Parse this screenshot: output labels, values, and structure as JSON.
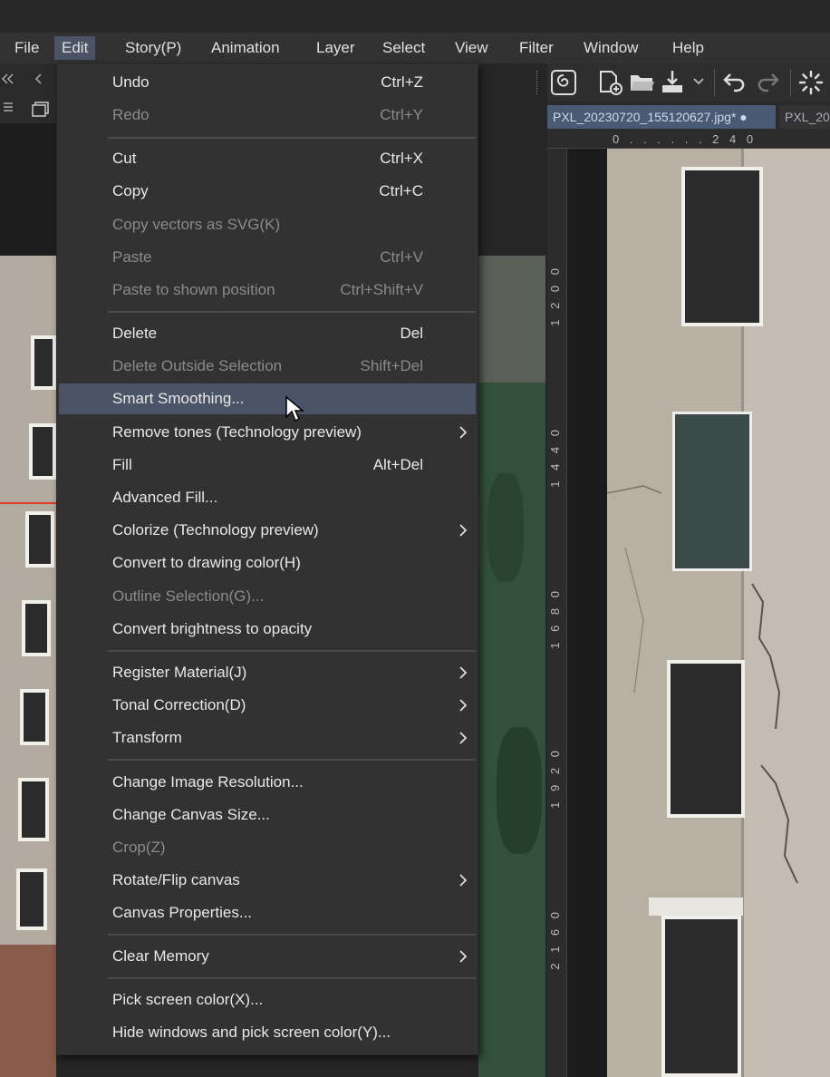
{
  "menubar": {
    "items": [
      "File",
      "Edit",
      "Story(P)",
      "Animation",
      "Layer",
      "Select",
      "View",
      "Filter",
      "Window",
      "Help"
    ],
    "active": "Edit"
  },
  "document": {
    "tabs": [
      "PXL_20230720_155120627.jpg* ●",
      "PXL_2023"
    ],
    "ruler_h_label": "0 . . . . . . 2 4 0",
    "ruler_v_labels": [
      "1 2 0 0",
      "1 4 4 0",
      "1 6 8 0",
      "1 9 2 0",
      "2 1 6 0"
    ]
  },
  "edit_menu": {
    "items": [
      {
        "label": "Undo",
        "shortcut": "Ctrl+Z",
        "disabled": false
      },
      {
        "label": "Redo",
        "shortcut": "Ctrl+Y",
        "disabled": true
      },
      {
        "label": "Cut",
        "shortcut": "Ctrl+X",
        "disabled": false
      },
      {
        "label": "Copy",
        "shortcut": "Ctrl+C",
        "disabled": false
      },
      {
        "label": "Copy vectors as SVG(K)",
        "shortcut": "",
        "disabled": true
      },
      {
        "label": "Paste",
        "shortcut": "Ctrl+V",
        "disabled": true
      },
      {
        "label": "Paste to shown position",
        "shortcut": "Ctrl+Shift+V",
        "disabled": true
      },
      {
        "label": "Delete",
        "shortcut": "Del",
        "disabled": false
      },
      {
        "label": "Delete Outside Selection",
        "shortcut": "Shift+Del",
        "disabled": true
      },
      {
        "label": "Smart Smoothing...",
        "shortcut": "",
        "disabled": false,
        "highlighted": true
      },
      {
        "label": "Remove tones (Technology preview)",
        "shortcut": "",
        "disabled": false,
        "submenu": true
      },
      {
        "label": "Fill",
        "shortcut": "Alt+Del",
        "disabled": false
      },
      {
        "label": "Advanced Fill...",
        "shortcut": "",
        "disabled": false
      },
      {
        "label": "Colorize (Technology preview)",
        "shortcut": "",
        "disabled": false,
        "submenu": true
      },
      {
        "label": "Convert to drawing color(H)",
        "shortcut": "",
        "disabled": false
      },
      {
        "label": "Outline Selection(G)...",
        "shortcut": "",
        "disabled": true
      },
      {
        "label": "Convert brightness to opacity",
        "shortcut": "",
        "disabled": false
      },
      {
        "label": "Register Material(J)",
        "shortcut": "",
        "disabled": false,
        "submenu": true
      },
      {
        "label": "Tonal Correction(D)",
        "shortcut": "",
        "disabled": false,
        "submenu": true
      },
      {
        "label": "Transform",
        "shortcut": "",
        "disabled": false,
        "submenu": true
      },
      {
        "label": "Change Image Resolution...",
        "shortcut": "",
        "disabled": false
      },
      {
        "label": "Change Canvas Size...",
        "shortcut": "",
        "disabled": false
      },
      {
        "label": "Crop(Z)",
        "shortcut": "",
        "disabled": true
      },
      {
        "label": "Rotate/Flip canvas",
        "shortcut": "",
        "disabled": false,
        "submenu": true
      },
      {
        "label": "Canvas Properties...",
        "shortcut": "",
        "disabled": false
      },
      {
        "label": "Clear Memory",
        "shortcut": "",
        "disabled": false,
        "submenu": true
      },
      {
        "label": "Pick screen color(X)...",
        "shortcut": "",
        "disabled": false
      },
      {
        "label": "Hide windows and pick screen color(Y)...",
        "shortcut": "",
        "disabled": false
      }
    ]
  },
  "colors": {
    "menu_bg": "#323232",
    "highlight": "#4b5466",
    "text": "#e8e8e8",
    "disabled_text": "#8a8a8a"
  }
}
